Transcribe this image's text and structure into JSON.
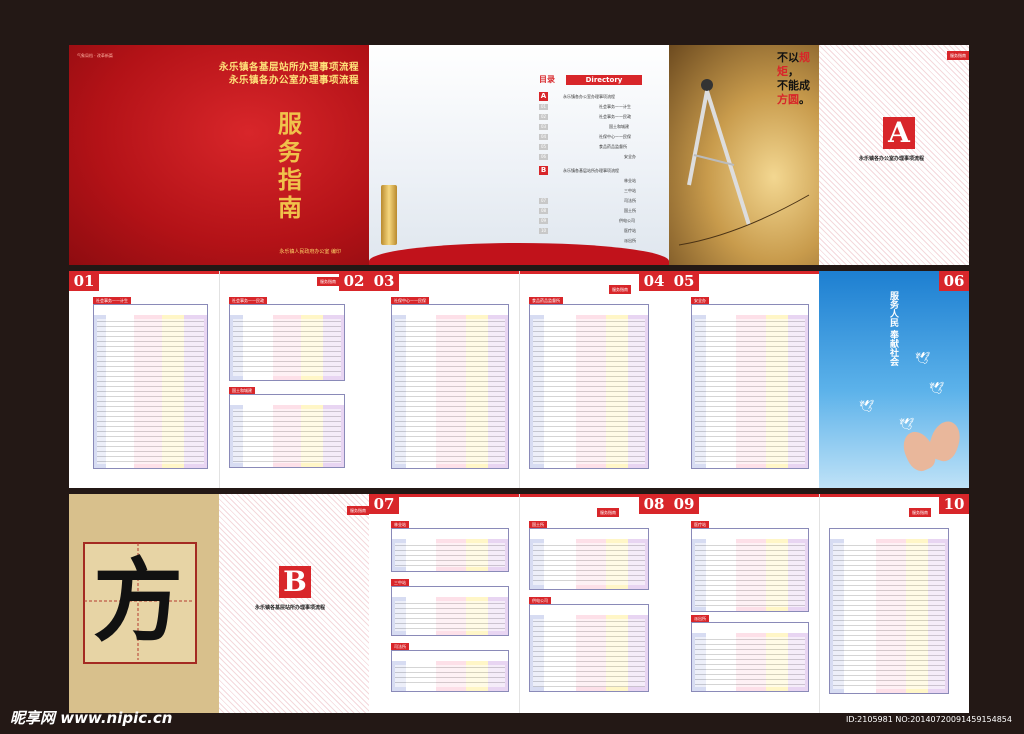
{
  "cover": {
    "tag": "气象局档 · 改革新篇",
    "title_line1": "永乐镇各基层站所办理事项流程",
    "title_line2": "永乐镇各办公室办理事项流程",
    "big_title": "服务指南",
    "footer": "永乐镇人民政府办公室 编印"
  },
  "toc": {
    "label": "目录",
    "head": "Directory",
    "letter_a": "A",
    "letter_b": "B",
    "items": [
      "永乐镇各办公室办理事项流程",
      "社会事务——计生",
      "社会事务——民政",
      "国土和城建",
      "社保中心——民保",
      "食品药品监督所",
      "安全办",
      "永乐镇各基层站所办理事项流程",
      "林业站",
      "三中站",
      "司法所",
      "国土所",
      "供电公司",
      "医疗站",
      "派出所"
    ],
    "nums": [
      "01",
      "02",
      "03",
      "04",
      "05",
      "06",
      "07",
      "08",
      "09",
      "10"
    ]
  },
  "slogan": {
    "l1": "不以",
    "r1": "规矩",
    "l2": "不能成",
    "r2": "方圆",
    "end": "。",
    "comma": "，"
  },
  "section_a": {
    "letter": "A",
    "caption": "永乐镇各办公室办理事项流程",
    "tag": "服务指南"
  },
  "section_b": {
    "letter": "B",
    "caption": "永乐镇各基层站所办理事项流程",
    "tag": "服务指南"
  },
  "fang": {
    "char": "方"
  },
  "sky": {
    "text": "服务人民 奉献社会"
  },
  "pages": {
    "p01": "01",
    "p02": "02",
    "p03": "03",
    "p04": "04",
    "p05": "05",
    "p06": "06",
    "p07": "07",
    "p08": "08",
    "p09": "09",
    "p10": "10"
  },
  "tables": {
    "t1": "社会事务——计生",
    "t2": "社会事务——民政",
    "t3": "国土和城建",
    "t4": "社保中心——民保",
    "t5": "食品药品监督所",
    "t6": "安全办",
    "t7": "林业站",
    "t8": "三中站",
    "t9": "司法所",
    "t10": "国土所",
    "t11": "供电公司",
    "t12": "医疗站",
    "t13": "派出所"
  },
  "col_headers": [
    "服务项目",
    "所需材料",
    "办理流程",
    "部门负责人",
    "具体经办人"
  ],
  "watermark": {
    "logo": "昵享网 www.nipic.cn",
    "id": "ID:2105981 NO:20140720091459154854"
  },
  "colors": {
    "accent": "#d8262a",
    "background": "#231815"
  }
}
